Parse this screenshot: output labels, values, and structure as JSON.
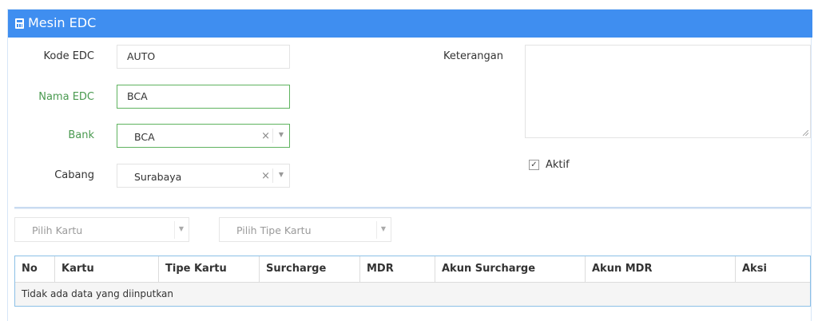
{
  "panel": {
    "title": "Mesin EDC",
    "title_icon": "calculator-icon"
  },
  "form": {
    "kode_edc": {
      "label": "Kode EDC",
      "value": "AUTO"
    },
    "nama_edc": {
      "label": "Nama EDC",
      "value": "BCA"
    },
    "bank": {
      "label": "Bank",
      "value": "BCA",
      "clear": "×",
      "caret": "▼"
    },
    "cabang": {
      "label": "Cabang",
      "value": "Surabaya",
      "clear": "×",
      "caret": "▼"
    },
    "keterangan": {
      "label": "Keterangan",
      "value": ""
    },
    "aktif": {
      "label": "Aktif",
      "checked": true,
      "mark": "✓"
    }
  },
  "filters": {
    "pilih_kartu": {
      "placeholder": "Pilih Kartu",
      "caret": "▼"
    },
    "pilih_tipe_kartu": {
      "placeholder": "Pilih Tipe Kartu",
      "caret": "▼"
    }
  },
  "table": {
    "headers": [
      "No",
      "Kartu",
      "Tipe Kartu",
      "Surcharge",
      "MDR",
      "Akun Surcharge",
      "Akun MDR",
      "Aksi"
    ],
    "empty_message": "Tidak ada data yang diinputkan"
  },
  "colors": {
    "header_bg": "#3f8ef0",
    "required_label": "#4a9a50",
    "table_border": "#8cc0e6"
  }
}
